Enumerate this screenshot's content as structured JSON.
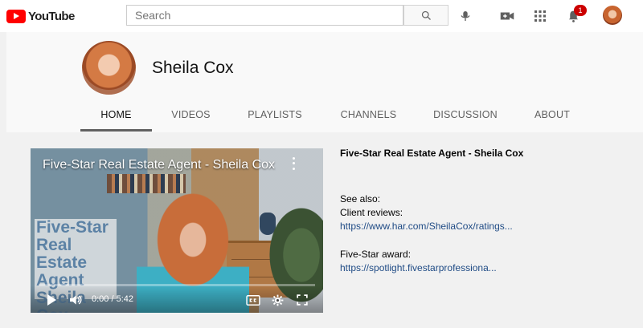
{
  "brand": {
    "logo_text": "YouTube",
    "accent": "#ff0000"
  },
  "search": {
    "placeholder": "Search"
  },
  "masthead": {
    "notifications_count": "1"
  },
  "channel": {
    "name": "Sheila Cox"
  },
  "tabs": [
    {
      "label": "HOME"
    },
    {
      "label": "VIDEOS"
    },
    {
      "label": "PLAYLISTS"
    },
    {
      "label": "CHANNELS"
    },
    {
      "label": "DISCUSSION"
    },
    {
      "label": "ABOUT"
    }
  ],
  "featured_video": {
    "title": "Five-Star Real Estate Agent - Sheila Cox",
    "overlay_text": "Five-Star Real Estate Agent Sheila Cox",
    "time": "0:00 / 5:42",
    "progress_fraction": 0
  },
  "description": {
    "title": "Five-Star Real Estate Agent - Sheila Cox",
    "see_also": "See also:",
    "reviews_label": "Client reviews:",
    "reviews_link": "https://www.har.com/SheilaCox/ratings...",
    "award_label": "Five-Star award:",
    "award_link": "https://spotlight.fivestarprofessiona..."
  },
  "icons": [
    "youtube-logo-icon",
    "search-icon",
    "microphone-icon",
    "create-video-icon",
    "apps-grid-icon",
    "notifications-bell-icon",
    "play-icon",
    "volume-icon",
    "captions-icon",
    "settings-gear-icon",
    "fullscreen-icon",
    "more-options-icon"
  ]
}
